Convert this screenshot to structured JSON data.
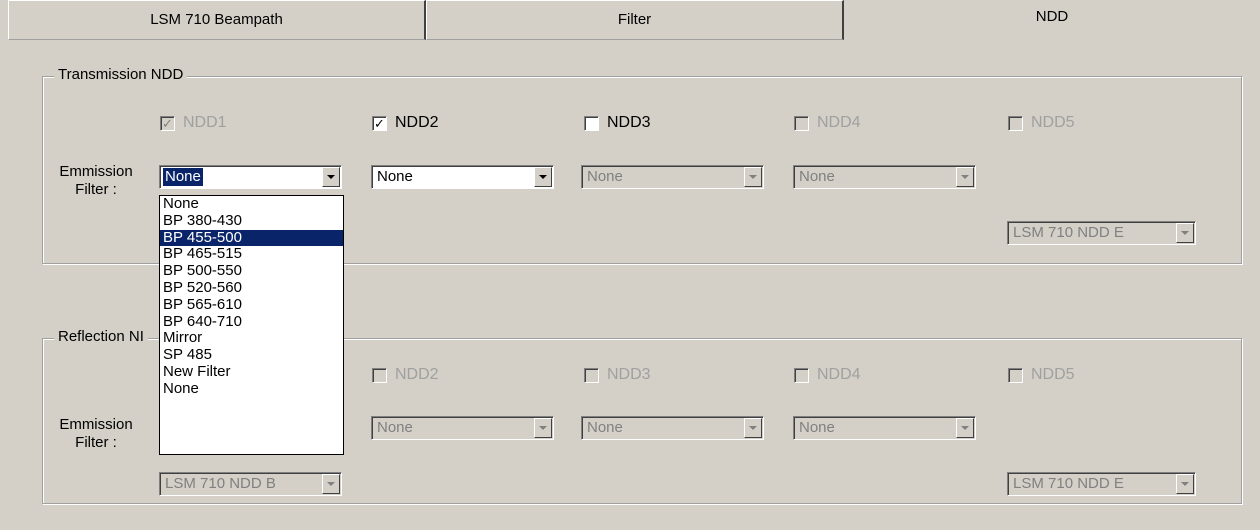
{
  "tabs": [
    {
      "label": "LSM 710 Beampath"
    },
    {
      "label": "Filter"
    },
    {
      "label": "NDD"
    }
  ],
  "transmission": {
    "legend": "Transmission NDD",
    "checkboxes": [
      {
        "label": "NDD1",
        "checked": true,
        "enabled": false
      },
      {
        "label": "NDD2",
        "checked": true,
        "enabled": true
      },
      {
        "label": "NDD3",
        "checked": false,
        "enabled": true
      },
      {
        "label": "NDD4",
        "checked": false,
        "enabled": false
      },
      {
        "label": "NDD5",
        "checked": false,
        "enabled": false
      }
    ],
    "filter_label_line1": "Emmission",
    "filter_label_line2": "Filter :",
    "filters": [
      "None",
      "None",
      "None",
      "None"
    ],
    "detector_select": "LSM 710 NDD E"
  },
  "reflection": {
    "legend": "Reflection NDD",
    "legend_visible": "Reflection NI",
    "checkboxes": [
      {
        "label": "NDD2",
        "checked": false,
        "enabled": false
      },
      {
        "label": "NDD3",
        "checked": false,
        "enabled": false
      },
      {
        "label": "NDD4",
        "checked": false,
        "enabled": false
      },
      {
        "label": "NDD5",
        "checked": false,
        "enabled": false
      }
    ],
    "filter_label_line1": "Emmission",
    "filter_label_line2": "Filter :",
    "filters": [
      "None",
      "None",
      "None"
    ],
    "detector_select_left": "LSM 710 NDD B",
    "detector_select_right": "LSM 710 NDD E"
  },
  "dropdown": {
    "options": [
      "None",
      "BP 380-430",
      "BP 455-500",
      "BP 465-515",
      "BP 500-550",
      "BP 520-560",
      "BP 565-610",
      "BP 640-710",
      "Mirror",
      "SP 485",
      "New Filter",
      "None"
    ],
    "highlighted": "BP 455-500"
  },
  "colors": {
    "window_bg": "#d4d0c8",
    "selection": "#0a246a",
    "disabled_text": "#a0a0a0"
  }
}
